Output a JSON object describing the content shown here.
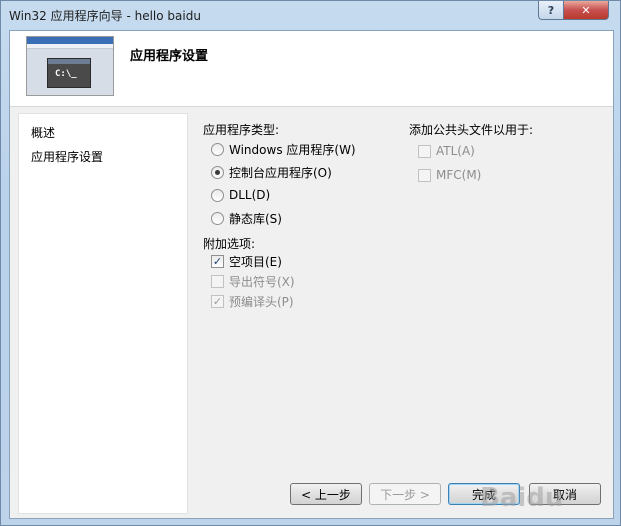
{
  "window": {
    "title": "Win32 应用程序向导 - hello baidu",
    "help_label": "?",
    "close_label": "✕"
  },
  "header": {
    "title": "应用程序设置",
    "thumbnail_prompt": "C:\\_"
  },
  "nav": {
    "items": [
      {
        "label": "概述"
      },
      {
        "label": "应用程序设置"
      }
    ]
  },
  "app_type": {
    "label": "应用程序类型:",
    "options": [
      {
        "label": "Windows 应用程序(W)",
        "checked": false
      },
      {
        "label": "控制台应用程序(O)",
        "checked": true
      },
      {
        "label": "DLL(D)",
        "checked": false
      },
      {
        "label": "静态库(S)",
        "checked": false
      }
    ]
  },
  "extra": {
    "label": "附加选项:",
    "options": [
      {
        "label": "空项目(E)",
        "checked": true,
        "enabled": true
      },
      {
        "label": "导出符号(X)",
        "checked": false,
        "enabled": false
      },
      {
        "label": "预编译头(P)",
        "checked": true,
        "enabled": false
      }
    ]
  },
  "common_headers": {
    "label": "添加公共头文件以用于:",
    "options": [
      {
        "label": "ATL(A)",
        "checked": false
      },
      {
        "label": "MFC(M)",
        "checked": false
      }
    ]
  },
  "buttons": {
    "prev": "< 上一步",
    "next": "下一步 >",
    "finish": "完成",
    "cancel": "取消"
  },
  "watermark": "Baidu"
}
